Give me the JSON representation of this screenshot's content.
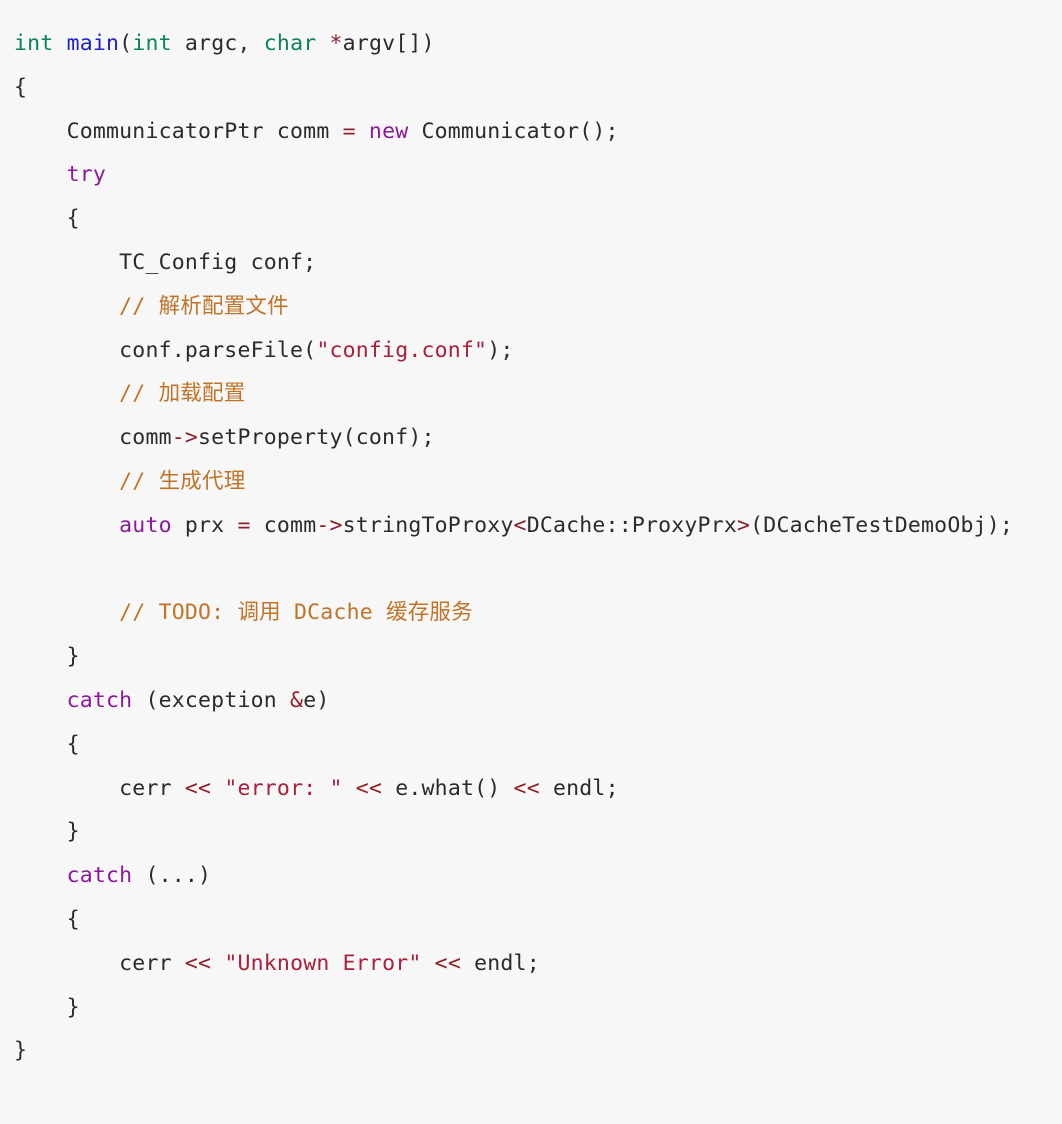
{
  "editor": {
    "language": "cpp",
    "background_color": "#f7f7f7",
    "foreground_color": "#2b2b2b",
    "palette": {
      "type_color": "#0b8457",
      "function_color": "#2020cc",
      "keyword_color": "#8b1a9b",
      "string_color": "#a8213a",
      "operator_color": "#8f1f26",
      "comment_color": "#bf7428"
    }
  },
  "code": {
    "lines": [
      {
        "id": "line-1",
        "indent": 0,
        "tokens": [
          {
            "t": "int",
            "k": "type"
          },
          {
            "t": " ",
            "k": "plain"
          },
          {
            "t": "main",
            "k": "fn"
          },
          {
            "t": "(",
            "k": "plain"
          },
          {
            "t": "int",
            "k": "type"
          },
          {
            "t": " argc, ",
            "k": "plain"
          },
          {
            "t": "char",
            "k": "type"
          },
          {
            "t": " ",
            "k": "plain"
          },
          {
            "t": "*",
            "k": "op"
          },
          {
            "t": "argv[])",
            "k": "plain"
          }
        ]
      },
      {
        "id": "line-2",
        "indent": 0,
        "tokens": [
          {
            "t": "{",
            "k": "plain"
          }
        ]
      },
      {
        "id": "line-3",
        "indent": 1,
        "tokens": [
          {
            "t": "CommunicatorPtr comm ",
            "k": "plain"
          },
          {
            "t": "=",
            "k": "op"
          },
          {
            "t": " ",
            "k": "plain"
          },
          {
            "t": "new",
            "k": "kw"
          },
          {
            "t": " Communicator();",
            "k": "plain"
          }
        ]
      },
      {
        "id": "line-4",
        "indent": 1,
        "tokens": [
          {
            "t": "try",
            "k": "kw"
          }
        ]
      },
      {
        "id": "line-5",
        "indent": 1,
        "tokens": [
          {
            "t": "{",
            "k": "plain"
          }
        ]
      },
      {
        "id": "line-6",
        "indent": 2,
        "tokens": [
          {
            "t": "TC_Config conf;",
            "k": "plain"
          }
        ]
      },
      {
        "id": "line-7",
        "indent": 2,
        "tokens": [
          {
            "t": "// 解析配置文件",
            "k": "comment"
          }
        ]
      },
      {
        "id": "line-8",
        "indent": 2,
        "tokens": [
          {
            "t": "conf.parseFile(",
            "k": "plain"
          },
          {
            "t": "\"config.conf\"",
            "k": "str"
          },
          {
            "t": ");",
            "k": "plain"
          }
        ]
      },
      {
        "id": "line-9",
        "indent": 2,
        "tokens": [
          {
            "t": "// 加载配置",
            "k": "comment"
          }
        ]
      },
      {
        "id": "line-10",
        "indent": 2,
        "tokens": [
          {
            "t": "comm",
            "k": "plain"
          },
          {
            "t": "->",
            "k": "op"
          },
          {
            "t": "setProperty(conf);",
            "k": "plain"
          }
        ]
      },
      {
        "id": "line-11",
        "indent": 2,
        "tokens": [
          {
            "t": "// 生成代理",
            "k": "comment"
          }
        ]
      },
      {
        "id": "line-12",
        "indent": 2,
        "tokens": [
          {
            "t": "auto",
            "k": "kw"
          },
          {
            "t": " prx ",
            "k": "plain"
          },
          {
            "t": "=",
            "k": "op"
          },
          {
            "t": " comm",
            "k": "plain"
          },
          {
            "t": "->",
            "k": "op"
          },
          {
            "t": "stringToProxy",
            "k": "plain"
          },
          {
            "t": "<",
            "k": "op"
          },
          {
            "t": "DCache::ProxyPrx",
            "k": "plain"
          },
          {
            "t": ">",
            "k": "op"
          },
          {
            "t": "(DCacheTestDemoObj);",
            "k": "plain"
          }
        ]
      },
      {
        "id": "line-13",
        "indent": 0,
        "blank": true,
        "tokens": []
      },
      {
        "id": "line-14",
        "indent": 2,
        "tokens": [
          {
            "t": "// TODO: 调用 DCache 缓存服务",
            "k": "comment"
          }
        ]
      },
      {
        "id": "line-15",
        "indent": 1,
        "tokens": [
          {
            "t": "}",
            "k": "plain"
          }
        ]
      },
      {
        "id": "line-16",
        "indent": 1,
        "tokens": [
          {
            "t": "catch",
            "k": "kw"
          },
          {
            "t": " (exception ",
            "k": "plain"
          },
          {
            "t": "&",
            "k": "op"
          },
          {
            "t": "e)",
            "k": "plain"
          }
        ]
      },
      {
        "id": "line-17",
        "indent": 1,
        "tokens": [
          {
            "t": "{",
            "k": "plain"
          }
        ]
      },
      {
        "id": "line-18",
        "indent": 2,
        "tokens": [
          {
            "t": "cerr ",
            "k": "plain"
          },
          {
            "t": "<<",
            "k": "op"
          },
          {
            "t": " ",
            "k": "plain"
          },
          {
            "t": "\"error: \"",
            "k": "str"
          },
          {
            "t": " ",
            "k": "plain"
          },
          {
            "t": "<<",
            "k": "op"
          },
          {
            "t": " e.what() ",
            "k": "plain"
          },
          {
            "t": "<<",
            "k": "op"
          },
          {
            "t": " endl;",
            "k": "plain"
          }
        ]
      },
      {
        "id": "line-19",
        "indent": 1,
        "tokens": [
          {
            "t": "}",
            "k": "plain"
          }
        ]
      },
      {
        "id": "line-20",
        "indent": 1,
        "tokens": [
          {
            "t": "catch",
            "k": "kw"
          },
          {
            "t": " (...)",
            "k": "plain"
          }
        ]
      },
      {
        "id": "line-21",
        "indent": 1,
        "tokens": [
          {
            "t": "{",
            "k": "plain"
          }
        ]
      },
      {
        "id": "line-22",
        "indent": 2,
        "tokens": [
          {
            "t": "cerr ",
            "k": "plain"
          },
          {
            "t": "<<",
            "k": "op"
          },
          {
            "t": " ",
            "k": "plain"
          },
          {
            "t": "\"Unknown Error\"",
            "k": "str"
          },
          {
            "t": " ",
            "k": "plain"
          },
          {
            "t": "<<",
            "k": "op"
          },
          {
            "t": " endl;",
            "k": "plain"
          }
        ]
      },
      {
        "id": "line-23",
        "indent": 1,
        "tokens": [
          {
            "t": "}",
            "k": "plain"
          }
        ]
      },
      {
        "id": "line-24",
        "indent": 0,
        "tokens": [
          {
            "t": "}",
            "k": "plain"
          }
        ]
      }
    ]
  }
}
